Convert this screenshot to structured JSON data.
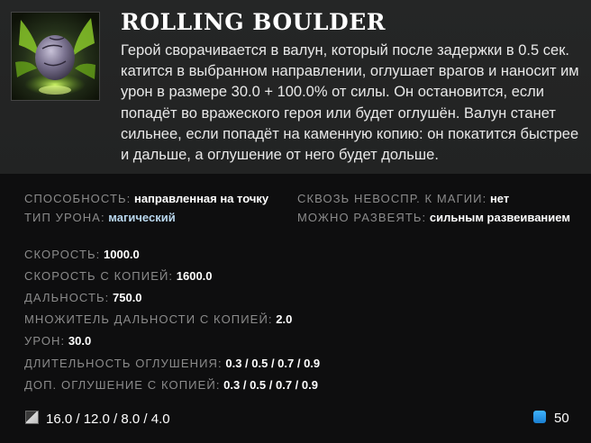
{
  "ability": {
    "title": "ROLLING BOULDER",
    "description": "Герой сворачивается в валун, который после задержки в 0.5 сек. катится в выбранном направлении, оглушает врагов и наносит им урон в размере 30.0 + 100.0% от силы. Он остановится, если попадёт во вражеского героя или будет оглушён. Валун станет сильнее, если попадёт на каменную копию: он покатится быстрее и дальше, а оглушение от него будет дольше.",
    "icon": "rolling-boulder-icon"
  },
  "attributes": {
    "ability_type": {
      "label": "СПОСОБНОСТЬ:",
      "value": "направленная на точку"
    },
    "spell_immunity": {
      "label": "СКВОЗЬ НЕВОСПР. К МАГИИ:",
      "value": "нет"
    },
    "damage_type": {
      "label": "ТИП УРОНА:",
      "value": "магический"
    },
    "dispellable": {
      "label": "МОЖНО РАЗВЕЯТЬ:",
      "value": "сильным развеиванием"
    }
  },
  "stats": [
    {
      "label": "СКОРОСТЬ:",
      "value": "1000.0"
    },
    {
      "label": "СКОРОСТЬ С КОПИЕЙ:",
      "value": "1600.0"
    },
    {
      "label": "ДАЛЬНОСТЬ:",
      "value": "750.0"
    },
    {
      "label": "МНОЖИТЕЛЬ ДАЛЬНОСТИ С КОПИЕЙ:",
      "value": "2.0"
    },
    {
      "label": "УРОН:",
      "value": "30.0"
    },
    {
      "label": "ДЛИТЕЛЬНОСТЬ ОГЛУШЕНИЯ:",
      "value": "0.3 / 0.5 / 0.7 / 0.9"
    },
    {
      "label": "ДОП. ОГЛУШЕНИЕ С КОПИЕЙ:",
      "value": "0.3 / 0.5 / 0.7 / 0.9"
    }
  ],
  "footer": {
    "cooldown": "16.0 / 12.0 / 8.0 / 4.0",
    "cooldown_icon": "cooldown-icon",
    "mana_cost": "50",
    "mana_icon": "mana-icon"
  },
  "colors": {
    "background": "#0e0e0f",
    "header_background": "#232424",
    "label": "#8b8b8b",
    "value": "#ffffff",
    "magic_damage": "#b9d7ee",
    "mana": "#2b95e8"
  }
}
